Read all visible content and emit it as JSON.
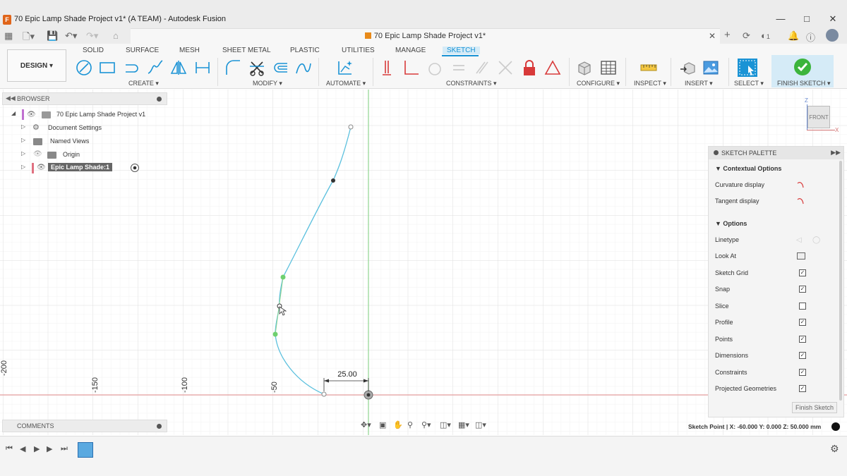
{
  "window": {
    "title": "70 Epic Lamp Shade Project v1* (A TEAM) - Autodesk Fusion",
    "minimize": "—",
    "maximize": "□",
    "close": "✕"
  },
  "document_tab": {
    "title": "70 Epic Lamp Shade Project v1*",
    "close": "✕"
  },
  "quick_access": {
    "notifications_count": "1"
  },
  "ribbon": {
    "workspace": "DESIGN ▾",
    "tabs": [
      "SOLID",
      "SURFACE",
      "MESH",
      "SHEET METAL",
      "PLASTIC",
      "UTILITIES",
      "MANAGE",
      "SKETCH"
    ],
    "active_tab": "SKETCH",
    "groups": {
      "create": "CREATE ▾",
      "modify": "MODIFY ▾",
      "automate": "AUTOMATE ▾",
      "constraints": "CONSTRAINTS ▾",
      "configure": "CONFIGURE ▾",
      "inspect": "INSPECT ▾",
      "insert": "INSERT ▾",
      "select": "SELECT ▾",
      "finish_sketch": "FINISH SKETCH ▾"
    }
  },
  "browser": {
    "title": "BROWSER",
    "items": [
      {
        "label": "70 Epic Lamp Shade Project v1"
      },
      {
        "label": "Document Settings"
      },
      {
        "label": "Named Views"
      },
      {
        "label": "Origin"
      },
      {
        "label": "Epic Lamp Shade:1"
      }
    ]
  },
  "comments": {
    "title": "COMMENTS"
  },
  "canvas": {
    "ruler_labels": [
      "-200",
      "-150",
      "-100",
      "-50"
    ],
    "dimension": "25.00",
    "viewcube_face": "FRONT",
    "axis_z": "Z",
    "axis_x": "X"
  },
  "sketch_palette": {
    "title": "SKETCH PALETTE",
    "contextual_title": "Contextual Options",
    "contextual": [
      {
        "label": "Curvature display"
      },
      {
        "label": "Tangent display"
      }
    ],
    "options_title": "Options",
    "options": [
      {
        "label": "Linetype",
        "control": "icons"
      },
      {
        "label": "Look At",
        "control": "icon"
      },
      {
        "label": "Sketch Grid",
        "checked": true
      },
      {
        "label": "Snap",
        "checked": true
      },
      {
        "label": "Slice",
        "checked": false
      },
      {
        "label": "Profile",
        "checked": true
      },
      {
        "label": "Points",
        "checked": true
      },
      {
        "label": "Dimensions",
        "checked": true
      },
      {
        "label": "Constraints",
        "checked": true
      },
      {
        "label": "Projected Geometries",
        "checked": true
      }
    ],
    "finish_button": "Finish Sketch"
  },
  "status": {
    "text": "Sketch Point | X: -60.000 Y: 0.000 Z: 50.000 mm"
  },
  "colors": {
    "accent": "#1a93d5",
    "curve": "#5bc0de",
    "green_axis": "#8fd48f",
    "red_axis": "#e8a0a0",
    "finish_bg": "#d5ebf7",
    "constraint_red": "#d83a3a"
  }
}
